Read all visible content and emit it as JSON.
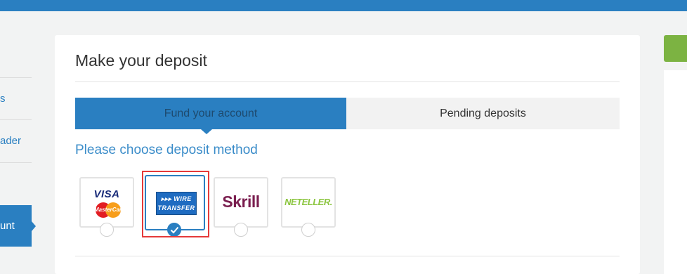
{
  "colors": {
    "primary": "#2a7fc1",
    "accent_green": "#7cb342",
    "selection_outline": "#e53a3a",
    "background": "#f2f3f3"
  },
  "sidebar": {
    "items": [
      {
        "label": "s"
      },
      {
        "label": "ader"
      }
    ],
    "active_item": {
      "label": "unt"
    }
  },
  "deposit": {
    "title": "Make your deposit",
    "tabs": [
      {
        "label": "Fund your account",
        "active": true
      },
      {
        "label": "Pending deposits",
        "active": false
      }
    ],
    "subheading": "Please choose deposit method",
    "methods": [
      {
        "name": "Visa / MasterCard",
        "logo_text": "VISA",
        "logo_subtext": "MasterCard",
        "selected": false
      },
      {
        "name": "Wire Transfer",
        "logo_text": "▸▸▸ WIRE",
        "logo_subtext": "TRANSFER",
        "selected": true
      },
      {
        "name": "Skrill",
        "logo_text": "Skrill",
        "selected": false
      },
      {
        "name": "Neteller",
        "logo_text": "NETELLER.",
        "selected": false
      }
    ]
  }
}
